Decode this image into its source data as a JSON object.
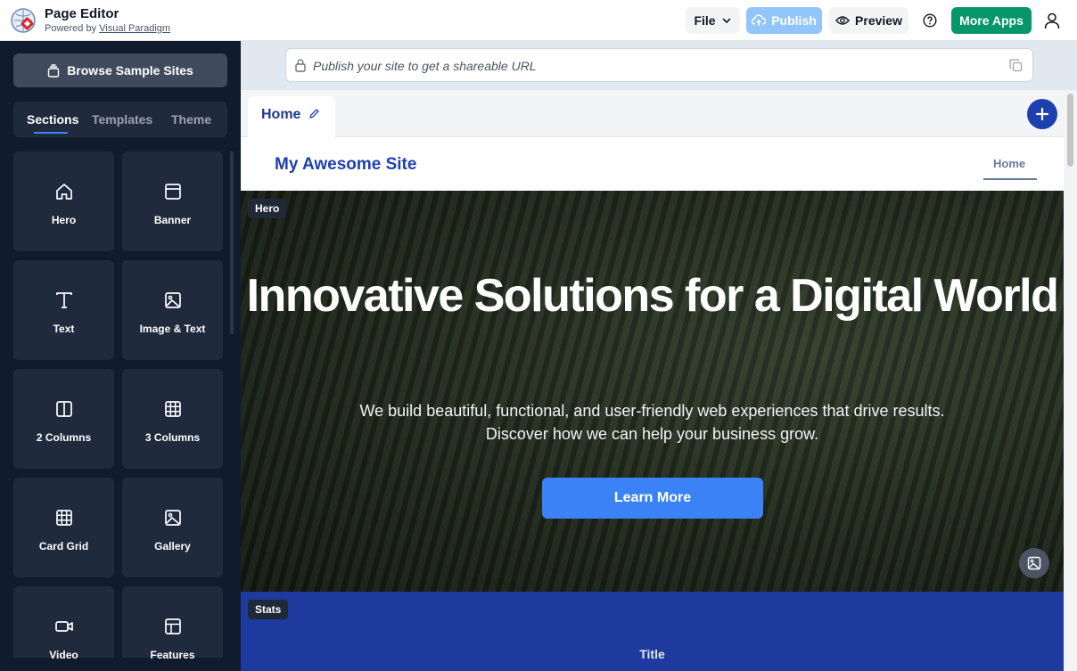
{
  "app": {
    "title": "Page Editor",
    "powered_prefix": "Powered by ",
    "powered_link": "Visual Paradigm"
  },
  "toolbar": {
    "file_label": "File",
    "publish_label": "Publish",
    "preview_label": "Preview",
    "more_apps_label": "More Apps"
  },
  "sidebar": {
    "browse_label": "Browse Sample Sites",
    "tabs": [
      "Sections",
      "Templates",
      "Theme"
    ],
    "active_tab": "Sections",
    "cards": [
      {
        "label": "Hero",
        "icon": "home-icon"
      },
      {
        "label": "Banner",
        "icon": "banner-icon"
      },
      {
        "label": "Text",
        "icon": "text-icon"
      },
      {
        "label": "Image & Text",
        "icon": "image-icon"
      },
      {
        "label": "2 Columns",
        "icon": "columns-icon"
      },
      {
        "label": "3 Columns",
        "icon": "grid-icon"
      },
      {
        "label": "Card Grid",
        "icon": "grid-icon"
      },
      {
        "label": "Gallery",
        "icon": "image-icon"
      },
      {
        "label": "Video",
        "icon": "video-icon"
      },
      {
        "label": "Features",
        "icon": "features-icon"
      }
    ]
  },
  "url_bar": {
    "placeholder": "Publish your site to get a shareable URL"
  },
  "page_tabs": {
    "home_label": "Home"
  },
  "site": {
    "title": "My Awesome Site",
    "nav_home": "Home"
  },
  "hero": {
    "badge": "Hero",
    "title": "Innovative Solutions for a Digital World",
    "subtitle_line1": "We build beautiful, functional, and user-friendly web experiences that drive results.",
    "subtitle_line2": "Discover how we can help your business grow.",
    "button_label": "Learn More"
  },
  "stats": {
    "badge": "Stats",
    "title": "Title"
  },
  "colors": {
    "accent_blue": "#3b82f6",
    "brand_navy": "#1e40af",
    "green": "#059669",
    "sidebar_bg": "#111b2e"
  }
}
